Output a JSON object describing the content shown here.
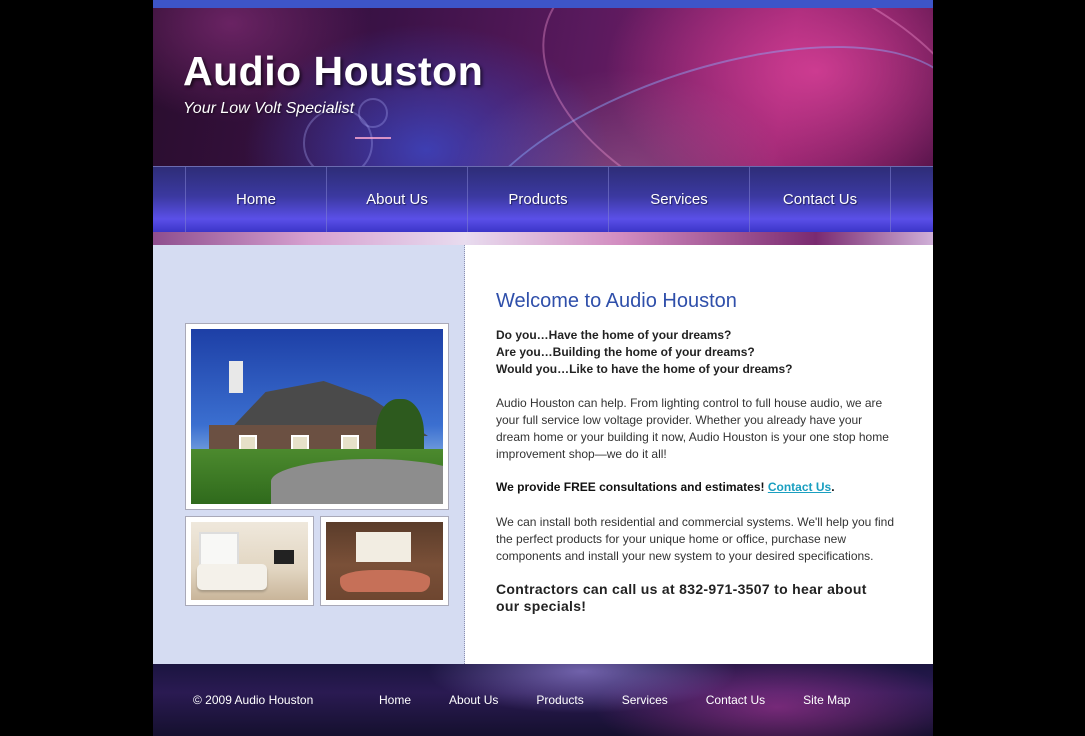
{
  "header": {
    "title": "Audio Houston",
    "tagline": "Your Low Volt Specialist"
  },
  "nav": {
    "items": [
      "Home",
      "About Us",
      "Products",
      "Services",
      "Contact Us"
    ]
  },
  "main": {
    "welcome": "Welcome to Audio Houston",
    "questions": [
      "Do you…Have the home of your dreams?",
      "Are you…Building the home of your dreams?",
      "Would you…Like to have the home of your dreams?"
    ],
    "intro": "Audio Houston can help. From lighting control to full house audio, we are your full service low voltage provider. Whether you already have your dream home or your building it now, Audio Houston is your one stop home improvement shop—we do it all!",
    "free_text": "We provide FREE consultations and estimates! ",
    "free_link": "Contact Us",
    "free_end": ".",
    "install": "We can install both residential and commercial systems. We'll help you find the perfect products for your unique home or office, purchase new components and install your new system to your desired specifications.",
    "contractors": "Contractors can call us at 832-971-3507 to hear about our specials!"
  },
  "footer": {
    "copyright": "© 2009 Audio Houston",
    "links": [
      "Home",
      "About Us",
      "Products",
      "Services",
      "Contact Us",
      "Site Map"
    ]
  },
  "colors": {
    "welcome_heading": "#2f4faa",
    "link": "#1a9fc0",
    "left_column": "#d5dcf2"
  }
}
